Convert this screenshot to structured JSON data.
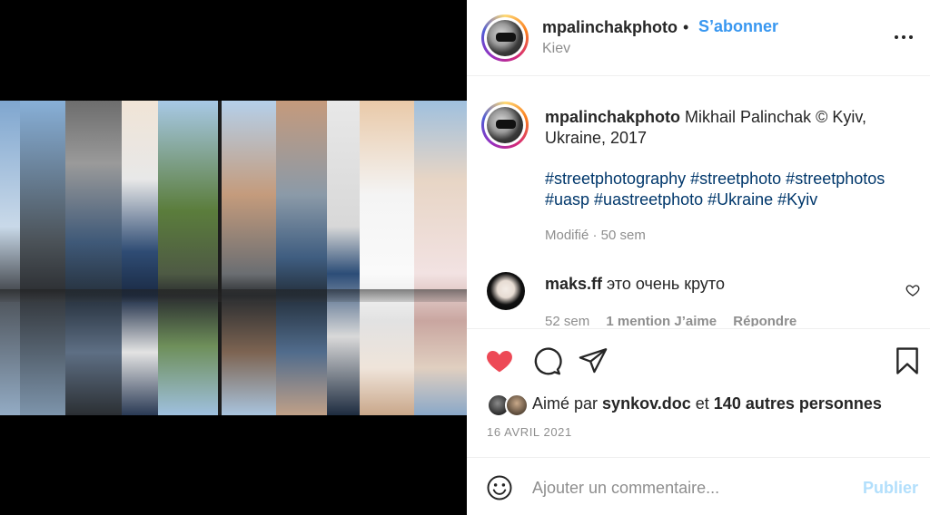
{
  "post": {
    "username": "mpalinchakphoto",
    "separator": "•",
    "follow_label": "S’abonner",
    "location": "Kiev"
  },
  "caption": {
    "username": "mpalinchakphoto",
    "text": "Mikhail Palinchak © Kyiv, Ukraine, 2017",
    "hashtags": "#streetphotography #streetphoto #streetphotos #uasp #uastreetphoto #Ukraine #Kyiv",
    "edited": "Modifié · 50 sem"
  },
  "comment": {
    "username": "maks.ff",
    "text": "это очень круто",
    "time": "52 sem",
    "likes": "1 mention J’aime",
    "reply": "Répondre"
  },
  "likes": {
    "prefix": "Aimé par",
    "user": "synkov.doc",
    "conjunction": "et",
    "others": "140 autres personnes"
  },
  "date": "16 AVRIL 2021",
  "add_comment": {
    "placeholder": "Ajouter un commentaire...",
    "publish_label": "Publier"
  },
  "colors": {
    "like_active": "#ed4956",
    "link": "#00376b",
    "follow": "#3897f0",
    "publish_disabled": "#b2dffc"
  },
  "icons": [
    "more-icon",
    "heart-icon",
    "comment-icon",
    "share-icon",
    "bookmark-icon",
    "emoji-icon"
  ]
}
